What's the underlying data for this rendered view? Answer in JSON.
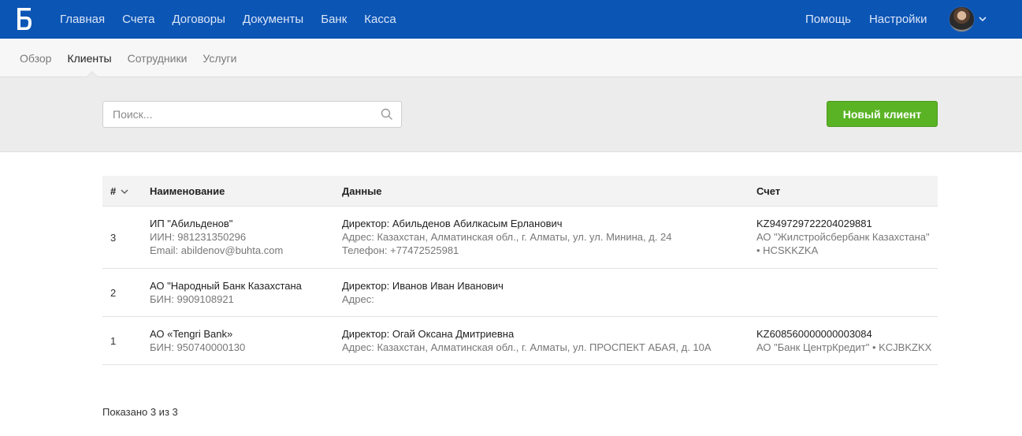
{
  "topnav": {
    "items": [
      "Главная",
      "Счета",
      "Договоры",
      "Документы",
      "Банк",
      "Касса"
    ],
    "right_items": [
      "Помощь",
      "Настройки"
    ]
  },
  "subnav": {
    "tabs": [
      "Обзор",
      "Клиенты",
      "Сотрудники",
      "Услуги"
    ],
    "active_tab": "Клиенты"
  },
  "toolbar": {
    "search_placeholder": "Поиск...",
    "new_client_label": "Новый клиент"
  },
  "table": {
    "headers": {
      "num": "#",
      "name": "Наименование",
      "data": "Данные",
      "account": "Счет"
    },
    "rows": [
      {
        "num": "3",
        "name": "ИП \"Абильденов\"",
        "name_sub": [
          "ИИН: 981231350296",
          "Email: abildenov@buhta.com"
        ],
        "director": "Директор: Абильденов Абилкасым Ерланович",
        "data_sub": [
          "Адрес: Казахстан, Алматинская обл., г. Алматы, ул. ул. Минина, д. 24",
          "Телефон: +77472525981"
        ],
        "account": "KZ949729722204029881",
        "account_sub": [
          "АО \"Жилстройсбербанк Казахстана\"",
          "• HCSKKZKA"
        ]
      },
      {
        "num": "2",
        "name": "АО \"Народный Банк Казахстана",
        "name_sub": [
          "БИН: 9909108921"
        ],
        "director": "Директор: Иванов Иван Иванович",
        "data_sub": [
          "Адрес:"
        ],
        "account": "",
        "account_sub": []
      },
      {
        "num": "1",
        "name": "АО «Tengri Bank»",
        "name_sub": [
          "БИН: 950740000130"
        ],
        "director": "Директор: Огай Оксана Дмитриевна",
        "data_sub": [
          "Адрес: Казахстан, Алматинская обл., г. Алматы, ул. ПРОСПЕКТ АБАЯ, д. 10А"
        ],
        "account": "KZ608560000000003084",
        "account_sub": [
          "АО \"Банк ЦентрКредит\" • KCJBKZKX"
        ]
      }
    ]
  },
  "footer": {
    "count_text": "Показано 3 из 3"
  },
  "colors": {
    "topbar": "#0b55b5",
    "primary_button": "#5ab324"
  },
  "icons": [
    "app-logo-icon",
    "search-icon",
    "sort-chevron-icon",
    "chevron-down-icon"
  ]
}
